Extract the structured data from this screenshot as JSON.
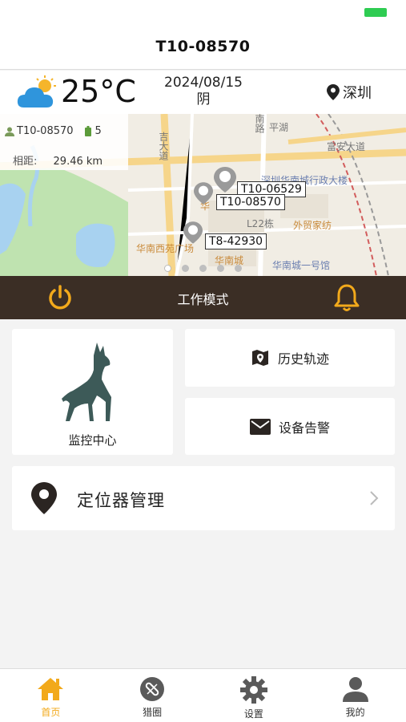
{
  "header": {
    "title": "T10-08570"
  },
  "weather": {
    "temperature": "25°C",
    "date": "2024/08/15",
    "condition": "阴",
    "city": "深圳",
    "icon": "partly-cloudy-icon"
  },
  "map": {
    "device_name": "T10-08570",
    "battery_level": "5",
    "distance_label": "相距:",
    "distance_value": "29.46 km",
    "markers": [
      {
        "label": "T10-06529"
      },
      {
        "label": "T10-08570"
      },
      {
        "label": "T8-42930"
      }
    ],
    "pois": {
      "admin_building": "深圳华南城行政大楼",
      "foreign_trade": "外贸家纺",
      "west_plaza": "华南西苑广场",
      "south_city": "华南城",
      "l22": "L22栋",
      "museum": "华南城一号馆",
      "fu_an_road": "富安大道",
      "ping_hu": "平湖",
      "hua": "华",
      "ji_road": "吉大道",
      "south_road": "南路"
    },
    "page_count": 5,
    "active_page": 0
  },
  "workbar": {
    "label": "工作模式",
    "power_icon": "power-icon",
    "bell_icon": "bell-icon"
  },
  "menu": {
    "monitor": "监控中心",
    "history": "历史轨迹",
    "alarm": "设备告警",
    "locator": "定位器管理"
  },
  "tabs": [
    {
      "label": "首页",
      "icon": "home-icon",
      "active": true
    },
    {
      "label": "猎圈",
      "icon": "circle-icon",
      "active": false
    },
    {
      "label": "设置",
      "icon": "gear-icon",
      "active": false
    },
    {
      "label": "我的",
      "icon": "user-icon",
      "active": false
    }
  ],
  "colors": {
    "accent": "#f2a91b",
    "workbar": "#3b2e25",
    "status_battery": "#2ecc52"
  }
}
